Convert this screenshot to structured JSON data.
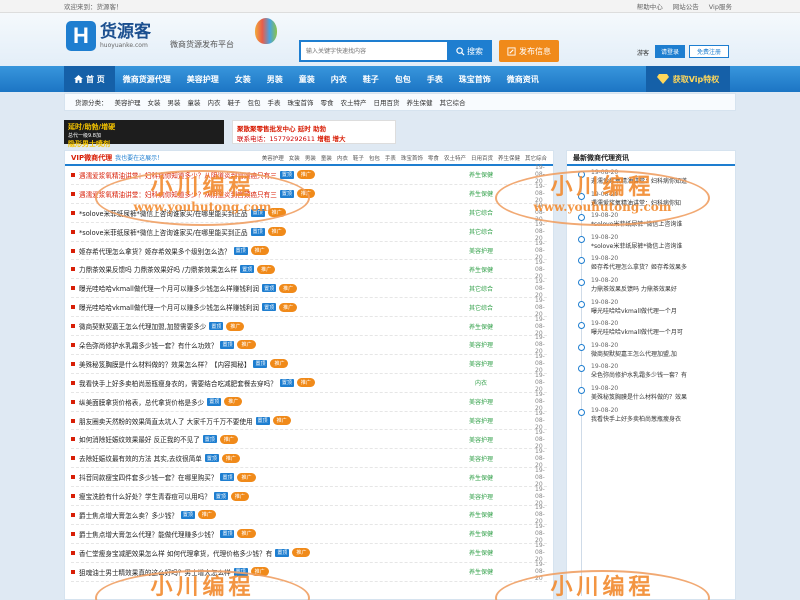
{
  "topbar": {
    "welcome": "欢迎来到：货源客！",
    "links": [
      "帮助中心",
      "网站公告",
      "Vip服务"
    ]
  },
  "header": {
    "logo_mark": "H",
    "logo_cn": "货源客",
    "logo_en": "huoyuanke.com",
    "slogan": "微商货源发布平台",
    "search_placeholder": "输入关键字快速找内容",
    "search_button": "搜索",
    "publish_button": "发布信息",
    "guest_label": "游客",
    "login_button": "请登录",
    "register_button": "免费注册"
  },
  "nav": {
    "items": [
      "首 页",
      "微商货源代理",
      "美容护理",
      "女装",
      "男装",
      "童装",
      "内衣",
      "鞋子",
      "包包",
      "手表",
      "珠宝首饰",
      "微商资讯"
    ],
    "vip": "获取Vip特权"
  },
  "categories": {
    "label": "货源分类：",
    "items": [
      "美容护理",
      "女装",
      "男装",
      "童装",
      "内衣",
      "鞋子",
      "包包",
      "手表",
      "珠宝首饰",
      "零食",
      "农土特产",
      "日用百货",
      "养生保健",
      "其它综合"
    ]
  },
  "ads": {
    "ad1_line1": "延时/助勃/增硬",
    "ad1_line2": "总代一级9.8加",
    "ad1_line3": "隐形男士喷剂",
    "ad2_line1": "聚散聚零售批发中心",
    "ad2_line2": "延时 助勃",
    "ad2_phone": "联系电话：15779292611",
    "ad2_line3": "增粗 增大"
  },
  "main": {
    "title": "VIP微商代理",
    "subtitle": "我也要在这展示！",
    "tabs": [
      "美容护理",
      "女装",
      "男装",
      "童装",
      "内衣",
      "鞋子",
      "包包",
      "手表",
      "珠宝首饰",
      "零食",
      "农土特产",
      "日用百货",
      "养生保健",
      "其它综合"
    ],
    "rows": [
      {
        "title": "遇濡爱浆氧精油讲堂：妇科病你知道多少？从阴道炎到宫颈癌只有三",
        "tag": "置顶",
        "pill": "推广",
        "cat": "养生保健",
        "date": "19-08-20",
        "red": true
      },
      {
        "title": "遇濡爱浆氧精油讲堂：妇科病你知道多少？从阴道炎到宫颈癌只有三",
        "tag": "置顶",
        "pill": "推广",
        "cat": "养生保健",
        "date": "19-08-20",
        "red": true
      },
      {
        "title": "*solove米菲纸尿裤*微信上咨询谁家买/在哪里能买到正品",
        "tag": "置顶",
        "pill": "推广",
        "cat": "其它综合",
        "date": "19-08-20",
        "red": false
      },
      {
        "title": "*solove米菲纸尿裤*微信上咨询谁家买/在哪里能买到正品",
        "tag": "置顶",
        "pill": "推广",
        "cat": "其它综合",
        "date": "19-08-20",
        "red": false
      },
      {
        "title": "姬存希代理怎么拿货？姬存希效果多个级别怎么选？",
        "tag": "置顶",
        "pill": "推广",
        "cat": "美容护理",
        "date": "19-08-20",
        "red": false
      },
      {
        "title": "力鼎茶效果反馈吗 力鼎茶效果好吗 /力鼎茶效果怎么样",
        "tag": "置顶",
        "pill": "推广",
        "cat": "养生保健",
        "date": "19-08-20",
        "red": false
      },
      {
        "title": "曝光哇哈哈vkmall做代理一个月可以赚多少钱怎么样赚钱利润",
        "tag": "置顶",
        "pill": "推广",
        "cat": "其它综合",
        "date": "19-08-20",
        "red": false
      },
      {
        "title": "曝光哇哈哈vkmall做代理一个月可以赚多少钱怎么样赚钱利润",
        "tag": "置顶",
        "pill": "推广",
        "cat": "其它综合",
        "date": "19-08-20",
        "red": false
      },
      {
        "title": "微商契默契嘉王怎么代理加盟,加盟需要多少",
        "tag": "置顶",
        "pill": "推广",
        "cat": "养生保健",
        "date": "19-08-20",
        "red": false
      },
      {
        "title": "朵色弥尚修护水乳霜多少钱一套？有什么功效？",
        "tag": "置顶",
        "pill": "推广",
        "cat": "美容护理",
        "date": "19-08-20",
        "red": false
      },
      {
        "title": "美殊秘笈胸膜是什么材料做的？效果怎么样？【内容揭秘】",
        "tag": "置顶",
        "pill": "推广",
        "cat": "美容护理",
        "date": "19-08-20",
        "red": false
      },
      {
        "title": "我看快手上好多卖柏尚葱瓶瘦身衣的，需要结合吃减肥套餐去穿吗？",
        "tag": "置顶",
        "pill": "推广",
        "cat": "内衣",
        "date": "19-08-20",
        "red": false
      },
      {
        "title": "纵美面膜拿货价格表，总代拿货价格是多少",
        "tag": "置顶",
        "pill": "推广",
        "cat": "美容护理",
        "date": "19-08-20",
        "red": false
      },
      {
        "title": "朋友圈卖天然粉的效果简直太坑人了 大家千万千万不要使用",
        "tag": "置顶",
        "pill": "推广",
        "cat": "美容护理",
        "date": "19-08-20",
        "red": false
      },
      {
        "title": "如何消除妊娠纹效果最好 反正我的不见了",
        "tag": "置顶",
        "pill": "推广",
        "cat": "美容护理",
        "date": "19-08-20",
        "red": false
      },
      {
        "title": "去除妊娠纹最有效的方法 其实,去纹很简单",
        "tag": "置顶",
        "pill": "推广",
        "cat": "美容护理",
        "date": "19-08-20",
        "red": false
      },
      {
        "title": "抖音同款瘦宝四件套多少钱一套？在哪里购买？",
        "tag": "置顶",
        "pill": "推广",
        "cat": "养生保健",
        "date": "19-08-20",
        "red": false
      },
      {
        "title": "瘦宝洗脸有什么好处？学生青春痘可以用吗？",
        "tag": "置顶",
        "pill": "推广",
        "cat": "美容护理",
        "date": "19-08-20",
        "red": false
      },
      {
        "title": "爵士焦点增大膏怎么卖？多少钱？",
        "tag": "置顶",
        "pill": "推广",
        "cat": "养生保健",
        "date": "19-08-20",
        "red": false
      },
      {
        "title": "爵士焦点增大膏怎么代理？能做代理赚多少钱？",
        "tag": "置顶",
        "pill": "推广",
        "cat": "养生保健",
        "date": "19-08-20",
        "red": false
      },
      {
        "title": "香仁堂瘦身宝减肥效果怎么样 如何代理拿货，代理价格多少钱？有",
        "tag": "置顶",
        "pill": "推广",
        "cat": "养生保健",
        "date": "19-08-20",
        "red": false
      },
      {
        "title": "狙魂油士男士精效果真的这么好吗？男士增大怎么样",
        "tag": "置顶",
        "pill": "推广",
        "cat": "养生保健",
        "date": "19-08-20",
        "red": false
      }
    ]
  },
  "sidebar": {
    "title": "最新微商代理资讯",
    "items": [
      {
        "date": "19-08-20",
        "text": "遇濡爱浆氧精油讲堂：妇科病你知道"
      },
      {
        "date": "19-08-20",
        "text": "遇濡爱浆氧精油讲堂：妇科病你知"
      },
      {
        "date": "19-08-20",
        "text": "*solove米菲纸尿裤*微信上咨询谁"
      },
      {
        "date": "19-08-20",
        "text": "*solove米菲纸尿裤*微信上咨询谁"
      },
      {
        "date": "19-08-20",
        "text": "姬存希代理怎么拿货？姬存希效果多"
      },
      {
        "date": "19-08-20",
        "text": "力鼎茶效果反馈吗 力鼎茶效果好"
      },
      {
        "date": "19-08-20",
        "text": "曝光哇哈哈vkmall做代理一个月"
      },
      {
        "date": "19-08-20",
        "text": "曝光哇哈哈vkmall做代理一个月可"
      },
      {
        "date": "19-08-20",
        "text": "微商契默契嘉王怎么代理加盟,加"
      },
      {
        "date": "19-08-20",
        "text": "朵色弥尚修护水乳霜多少钱一套？有"
      },
      {
        "date": "19-08-20",
        "text": "美殊秘笈胸膜是什么材料做的？效果"
      },
      {
        "date": "19-08-20",
        "text": "我看快手上好多卖柏尚葱瓶瘦身衣"
      }
    ]
  },
  "watermark": {
    "cn": "小川编程",
    "url": "www.youhutong.com"
  },
  "colors": {
    "primary": "#1e7ed0",
    "accent": "#f08a1a",
    "hot": "#d81e06",
    "watermark": "#f28a2e"
  }
}
